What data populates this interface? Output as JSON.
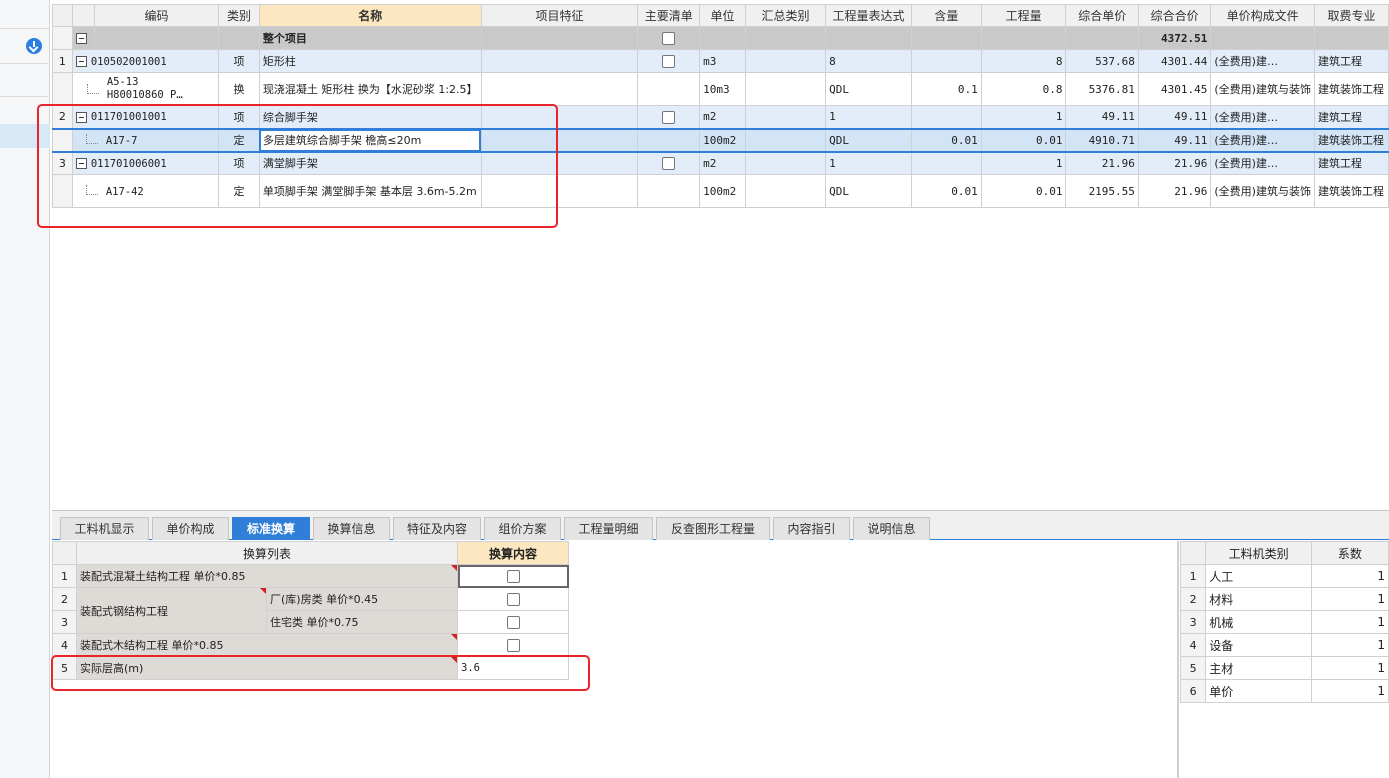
{
  "main_table": {
    "columns": [
      "",
      "",
      "编码",
      "类别",
      "名称",
      "项目特征",
      "主要清单",
      "单位",
      "汇总类别",
      "工程量表达式",
      "含量",
      "工程量",
      "综合单价",
      "综合合价",
      "单价构成文件",
      "取费专业"
    ],
    "root_row": {
      "name": "整个项目",
      "total": "4372.51"
    },
    "rows": [
      {
        "idx": "1",
        "code": "010502001001",
        "type": "项",
        "name": "矩形柱",
        "unit": "m3",
        "expr": "8",
        "amount": "",
        "qty": "8",
        "unit_price": "537.68",
        "total_price": "4301.44",
        "price_file": "(全费用)建…",
        "fee_type": "建筑工程"
      },
      {
        "idx": "",
        "code": "A5-13 H80010860 P…",
        "type": "换",
        "name": "现浇混凝土 矩形柱  换为【水泥砂浆 1:2.5】",
        "unit": "10m3",
        "expr": "QDL",
        "amount": "0.1",
        "qty": "0.8",
        "unit_price": "5376.81",
        "total_price": "4301.45",
        "price_file": "(全费用)建筑与装饰",
        "fee_type": "建筑装饰工程"
      },
      {
        "idx": "2",
        "code": "011701001001",
        "type": "项",
        "name": "综合脚手架",
        "unit": "m2",
        "expr": "1",
        "amount": "",
        "qty": "1",
        "unit_price": "49.11",
        "total_price": "49.11",
        "price_file": "(全费用)建…",
        "fee_type": "建筑工程"
      },
      {
        "idx": "",
        "code": "A17-7",
        "type": "定",
        "name": "多层建筑综合脚手架 檐高≤20m",
        "unit": "100m2",
        "expr": "QDL",
        "amount": "0.01",
        "qty": "0.01",
        "unit_price": "4910.71",
        "total_price": "49.11",
        "price_file": "(全费用)建…",
        "fee_type": "建筑装饰工程"
      },
      {
        "idx": "3",
        "code": "011701006001",
        "type": "项",
        "name": "满堂脚手架",
        "unit": "m2",
        "expr": "1",
        "amount": "",
        "qty": "1",
        "unit_price": "21.96",
        "total_price": "21.96",
        "price_file": "(全费用)建…",
        "fee_type": "建筑工程"
      },
      {
        "idx": "",
        "code": "A17-42",
        "type": "定",
        "name": "单项脚手架 满堂脚手架 基本层 3.6m-5.2m",
        "unit": "100m2",
        "expr": "QDL",
        "amount": "0.01",
        "qty": "0.01",
        "unit_price": "2195.55",
        "total_price": "21.96",
        "price_file": "(全费用)建筑与装饰",
        "fee_type": "建筑装饰工程"
      }
    ]
  },
  "tabs": [
    "工料机显示",
    "单价构成",
    "标准换算",
    "换算信息",
    "特征及内容",
    "组价方案",
    "工程量明细",
    "反查图形工程量",
    "内容指引",
    "说明信息"
  ],
  "active_tab": "标准换算",
  "conversion_table": {
    "header_list": "换算列表",
    "header_content": "换算内容",
    "rows": [
      {
        "idx": "1",
        "label": "装配式混凝土结构工程 单价*0.85"
      },
      {
        "idx": "2",
        "group": "装配式钢结构工程",
        "label": "厂(库)房类 单价*0.45"
      },
      {
        "idx": "3",
        "label": "住宅类 单价*0.75"
      },
      {
        "idx": "4",
        "label": "装配式木结构工程 单价*0.85"
      },
      {
        "idx": "5",
        "label": "实际层高(m)",
        "value": "3.6"
      }
    ]
  },
  "coef_table": {
    "header_type": "工料机类别",
    "header_coef": "系数",
    "rows": [
      {
        "idx": "1",
        "type": "人工",
        "coef": "1"
      },
      {
        "idx": "2",
        "type": "材料",
        "coef": "1"
      },
      {
        "idx": "3",
        "type": "机械",
        "coef": "1"
      },
      {
        "idx": "4",
        "type": "设备",
        "coef": "1"
      },
      {
        "idx": "5",
        "type": "主材",
        "coef": "1"
      },
      {
        "idx": "6",
        "type": "单价",
        "coef": "1"
      }
    ]
  },
  "colors": {
    "accent": "#2f7fd9",
    "annotation": "#e8262a",
    "header_highlight": "#fce7c1"
  },
  "icons": {
    "left_strip": "download-icon"
  }
}
